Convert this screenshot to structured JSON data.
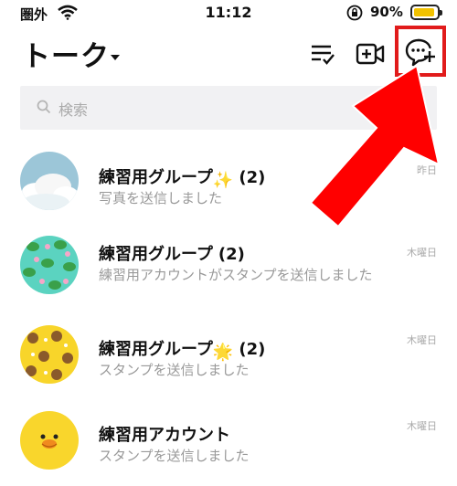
{
  "status_bar": {
    "carrier": "圏外",
    "time": "11:12",
    "battery_percent": "90%",
    "battery_level": 0.9
  },
  "header": {
    "title": "トーク"
  },
  "search": {
    "placeholder": "検索"
  },
  "chats": [
    {
      "name": "練習用グループ",
      "emoji": "✨",
      "count": "(2)",
      "message": "写真を送信しました",
      "date": "昨日",
      "avatar": "sky-clouds"
    },
    {
      "name": "練習用グループ",
      "emoji": "",
      "count": "(2)",
      "message": "練習用アカウントがスタンプを送信しました",
      "date": "木曜日",
      "avatar": "frog-pattern"
    },
    {
      "name": "練習用グループ",
      "emoji": "🌟",
      "count": "(2)",
      "message": "スタンプを送信しました",
      "date": "木曜日",
      "avatar": "bear-pattern"
    },
    {
      "name": "練習用アカウント",
      "emoji": "",
      "count": "",
      "message": "スタンプを送信しました",
      "date": "木曜日",
      "avatar": "chick"
    }
  ],
  "colors": {
    "highlight": "#e11b1b",
    "battery": "#f2c200"
  }
}
